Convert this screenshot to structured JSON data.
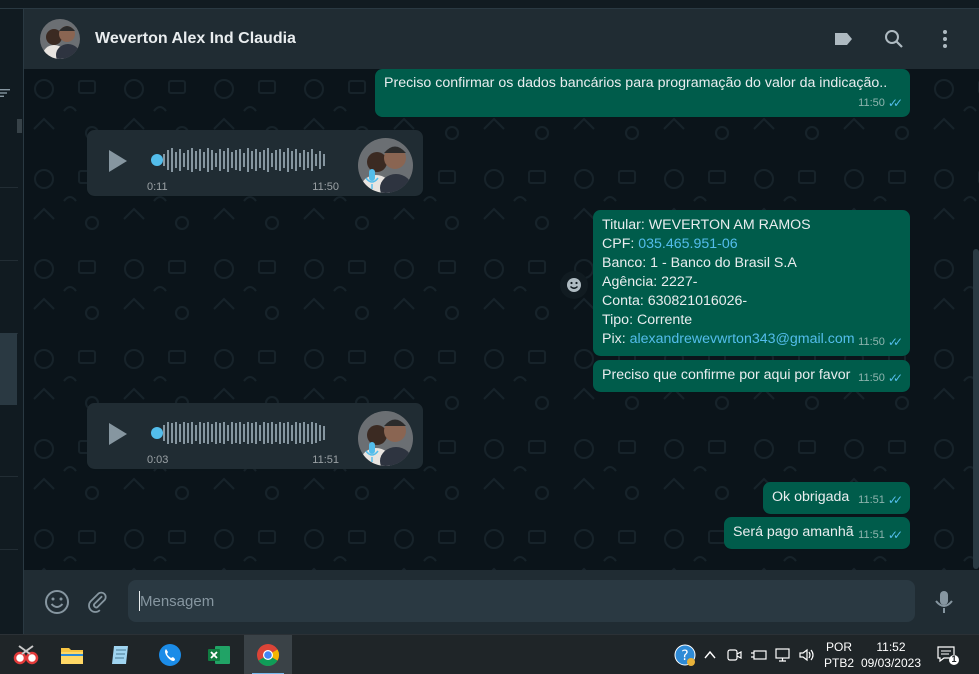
{
  "chat": {
    "contact_name": "Weverton Alex Ind Claudia",
    "input_placeholder": "Mensagem",
    "messages": [
      {
        "type": "text",
        "dir": "out",
        "text": "Preciso confirmar os dados bancários para programação do valor da indicação..",
        "time": "11:50"
      },
      {
        "type": "voice",
        "dir": "in",
        "duration": "0:11",
        "time": "11:50"
      },
      {
        "type": "text",
        "dir": "out",
        "lines": [
          "Titular: WEVERTON AM RAMOS",
          "CPF: ",
          "035.465.951-06",
          "Banco: 1 - Banco do Brasil S.A",
          "Agência: 2227-",
          "Conta: 630821016026-",
          "Tipo: Corrente",
          "Pix: ",
          "alexandrewevwrton343@gmail.com"
        ],
        "time": "11:50"
      },
      {
        "type": "text",
        "dir": "out",
        "text": "Preciso que confirme por aqui por favor",
        "time": "11:50"
      },
      {
        "type": "voice",
        "dir": "in",
        "duration": "0:03",
        "time": "11:51"
      },
      {
        "type": "text",
        "dir": "out",
        "text": "Ok obrigada",
        "time": "11:51"
      },
      {
        "type": "text",
        "dir": "out",
        "text": "Será pago amanhã",
        "time": "11:51"
      }
    ]
  },
  "taskbar": {
    "lang_top": "POR",
    "lang_bottom": "PTB2",
    "time": "11:52",
    "date": "09/03/2023",
    "notification_count": "1",
    "apps": [
      "snipping-tool",
      "file-explorer",
      "notepad",
      "phone-app",
      "excel",
      "chrome"
    ]
  },
  "colors": {
    "outgoing_bubble": "#005c4b",
    "incoming_bubble": "#202c33",
    "header": "#202c33",
    "background": "#0b141a",
    "read_ticks": "#53bdeb"
  }
}
